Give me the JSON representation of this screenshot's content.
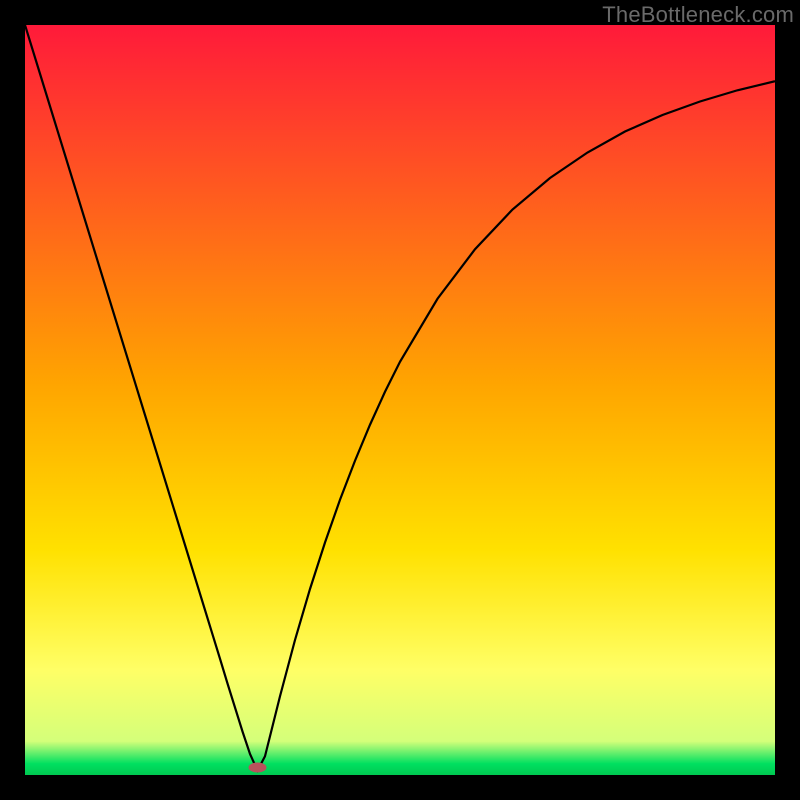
{
  "watermark": "TheBottleneck.com",
  "chart_data": {
    "type": "line",
    "title": "",
    "xlabel": "",
    "ylabel": "",
    "xlim": [
      0,
      100
    ],
    "ylim": [
      0,
      100
    ],
    "grid": false,
    "legend": false,
    "background_gradient": [
      {
        "stop": 0.0,
        "color": "#ff1a3a"
      },
      {
        "stop": 0.48,
        "color": "#ffa500"
      },
      {
        "stop": 0.7,
        "color": "#ffe100"
      },
      {
        "stop": 0.86,
        "color": "#ffff66"
      },
      {
        "stop": 0.955,
        "color": "#d4ff7a"
      },
      {
        "stop": 0.985,
        "color": "#00e060"
      },
      {
        "stop": 1.0,
        "color": "#00c851"
      }
    ],
    "minimum_marker": {
      "x": 31,
      "y": 1,
      "color": "#b7535c",
      "rx": 9,
      "ry": 5
    },
    "series": [
      {
        "name": "bottleneck-curve",
        "color": "#000000",
        "x": [
          0,
          2,
          4,
          6,
          8,
          10,
          12,
          14,
          16,
          18,
          20,
          22,
          24,
          26,
          27,
          28,
          29,
          30,
          31,
          32,
          33,
          34,
          36,
          38,
          40,
          42,
          44,
          46,
          48,
          50,
          55,
          60,
          65,
          70,
          75,
          80,
          85,
          90,
          95,
          100
        ],
        "values": [
          100,
          93.5,
          87,
          80.5,
          74,
          67.5,
          61,
          54.5,
          48,
          41.5,
          35,
          28.5,
          22,
          15.5,
          12.2,
          9,
          5.8,
          2.8,
          0.6,
          2.5,
          6.5,
          10.5,
          18,
          24.8,
          31,
          36.7,
          41.9,
          46.7,
          51.1,
          55.1,
          63.5,
          70.1,
          75.4,
          79.6,
          83,
          85.8,
          88,
          89.8,
          91.3,
          92.5
        ]
      }
    ]
  }
}
